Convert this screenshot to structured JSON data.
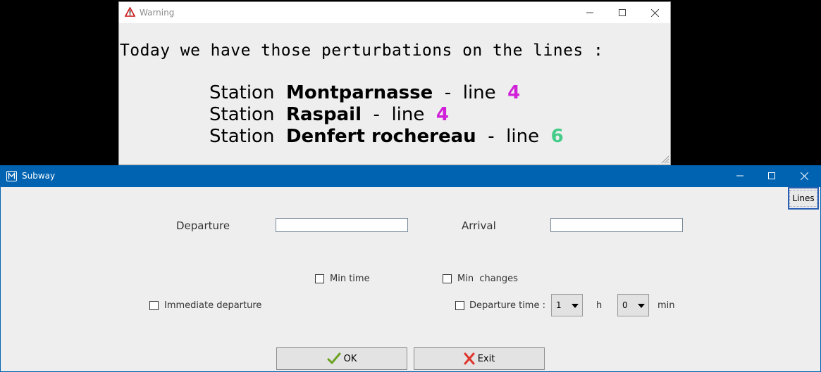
{
  "warning": {
    "title": "Warning",
    "heading": "Today we have those perturbations on the lines :",
    "station_word": "Station",
    "dash": "-",
    "line_word": "line",
    "items": [
      {
        "station": "Montparnasse",
        "line": "4",
        "color": "#d020d8"
      },
      {
        "station": "Raspail",
        "line": "4",
        "color": "#d020d8"
      },
      {
        "station": "Denfert rochereau",
        "line": "6",
        "color": "#44cc88"
      }
    ]
  },
  "subway": {
    "title": "Subway",
    "lines_button": "Lines",
    "departure_label": "Departure",
    "departure_value": "",
    "arrival_label": "Arrival",
    "arrival_value": "",
    "min_time_label": "Min time",
    "min_changes_label": "Min  changes",
    "immediate_departure_label": "Immediate departure",
    "departure_time_label": "Departure time :",
    "hour_value": "1",
    "hour_unit": "h",
    "minute_value": "0",
    "minute_unit": "min",
    "ok_label": "OK",
    "exit_label": "Exit"
  },
  "colors": {
    "titlebar_blue": "#0063b1",
    "line4": "#d020d8",
    "line6": "#44cc88",
    "ok_check": "#6aa121",
    "exit_x": "#e0362c"
  }
}
